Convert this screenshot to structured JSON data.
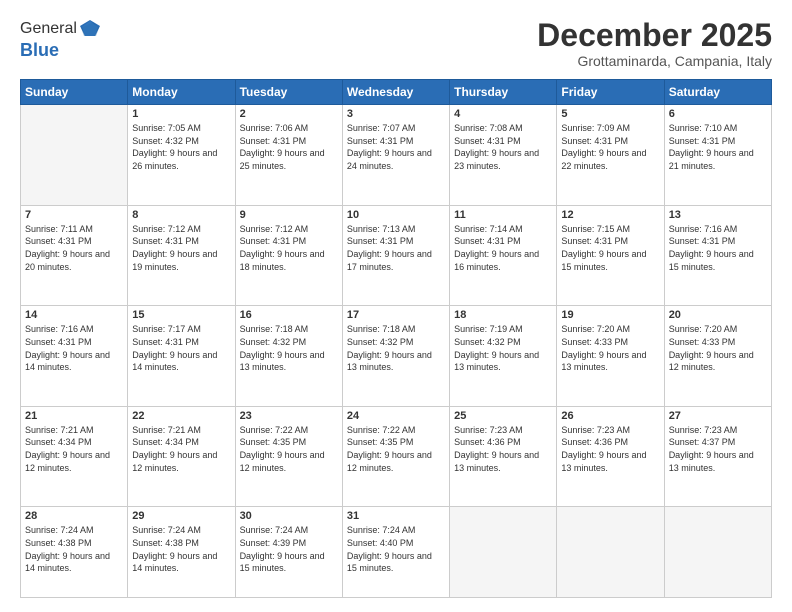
{
  "logo": {
    "general": "General",
    "blue": "Blue"
  },
  "header": {
    "month": "December 2025",
    "location": "Grottaminarda, Campania, Italy"
  },
  "days": [
    "Sunday",
    "Monday",
    "Tuesday",
    "Wednesday",
    "Thursday",
    "Friday",
    "Saturday"
  ],
  "weeks": [
    [
      {
        "num": "",
        "sunrise": "",
        "sunset": "",
        "daylight": ""
      },
      {
        "num": "1",
        "sunrise": "Sunrise: 7:05 AM",
        "sunset": "Sunset: 4:32 PM",
        "daylight": "Daylight: 9 hours and 26 minutes."
      },
      {
        "num": "2",
        "sunrise": "Sunrise: 7:06 AM",
        "sunset": "Sunset: 4:31 PM",
        "daylight": "Daylight: 9 hours and 25 minutes."
      },
      {
        "num": "3",
        "sunrise": "Sunrise: 7:07 AM",
        "sunset": "Sunset: 4:31 PM",
        "daylight": "Daylight: 9 hours and 24 minutes."
      },
      {
        "num": "4",
        "sunrise": "Sunrise: 7:08 AM",
        "sunset": "Sunset: 4:31 PM",
        "daylight": "Daylight: 9 hours and 23 minutes."
      },
      {
        "num": "5",
        "sunrise": "Sunrise: 7:09 AM",
        "sunset": "Sunset: 4:31 PM",
        "daylight": "Daylight: 9 hours and 22 minutes."
      },
      {
        "num": "6",
        "sunrise": "Sunrise: 7:10 AM",
        "sunset": "Sunset: 4:31 PM",
        "daylight": "Daylight: 9 hours and 21 minutes."
      }
    ],
    [
      {
        "num": "7",
        "sunrise": "Sunrise: 7:11 AM",
        "sunset": "Sunset: 4:31 PM",
        "daylight": "Daylight: 9 hours and 20 minutes."
      },
      {
        "num": "8",
        "sunrise": "Sunrise: 7:12 AM",
        "sunset": "Sunset: 4:31 PM",
        "daylight": "Daylight: 9 hours and 19 minutes."
      },
      {
        "num": "9",
        "sunrise": "Sunrise: 7:12 AM",
        "sunset": "Sunset: 4:31 PM",
        "daylight": "Daylight: 9 hours and 18 minutes."
      },
      {
        "num": "10",
        "sunrise": "Sunrise: 7:13 AM",
        "sunset": "Sunset: 4:31 PM",
        "daylight": "Daylight: 9 hours and 17 minutes."
      },
      {
        "num": "11",
        "sunrise": "Sunrise: 7:14 AM",
        "sunset": "Sunset: 4:31 PM",
        "daylight": "Daylight: 9 hours and 16 minutes."
      },
      {
        "num": "12",
        "sunrise": "Sunrise: 7:15 AM",
        "sunset": "Sunset: 4:31 PM",
        "daylight": "Daylight: 9 hours and 15 minutes."
      },
      {
        "num": "13",
        "sunrise": "Sunrise: 7:16 AM",
        "sunset": "Sunset: 4:31 PM",
        "daylight": "Daylight: 9 hours and 15 minutes."
      }
    ],
    [
      {
        "num": "14",
        "sunrise": "Sunrise: 7:16 AM",
        "sunset": "Sunset: 4:31 PM",
        "daylight": "Daylight: 9 hours and 14 minutes."
      },
      {
        "num": "15",
        "sunrise": "Sunrise: 7:17 AM",
        "sunset": "Sunset: 4:31 PM",
        "daylight": "Daylight: 9 hours and 14 minutes."
      },
      {
        "num": "16",
        "sunrise": "Sunrise: 7:18 AM",
        "sunset": "Sunset: 4:32 PM",
        "daylight": "Daylight: 9 hours and 13 minutes."
      },
      {
        "num": "17",
        "sunrise": "Sunrise: 7:18 AM",
        "sunset": "Sunset: 4:32 PM",
        "daylight": "Daylight: 9 hours and 13 minutes."
      },
      {
        "num": "18",
        "sunrise": "Sunrise: 7:19 AM",
        "sunset": "Sunset: 4:32 PM",
        "daylight": "Daylight: 9 hours and 13 minutes."
      },
      {
        "num": "19",
        "sunrise": "Sunrise: 7:20 AM",
        "sunset": "Sunset: 4:33 PM",
        "daylight": "Daylight: 9 hours and 13 minutes."
      },
      {
        "num": "20",
        "sunrise": "Sunrise: 7:20 AM",
        "sunset": "Sunset: 4:33 PM",
        "daylight": "Daylight: 9 hours and 12 minutes."
      }
    ],
    [
      {
        "num": "21",
        "sunrise": "Sunrise: 7:21 AM",
        "sunset": "Sunset: 4:34 PM",
        "daylight": "Daylight: 9 hours and 12 minutes."
      },
      {
        "num": "22",
        "sunrise": "Sunrise: 7:21 AM",
        "sunset": "Sunset: 4:34 PM",
        "daylight": "Daylight: 9 hours and 12 minutes."
      },
      {
        "num": "23",
        "sunrise": "Sunrise: 7:22 AM",
        "sunset": "Sunset: 4:35 PM",
        "daylight": "Daylight: 9 hours and 12 minutes."
      },
      {
        "num": "24",
        "sunrise": "Sunrise: 7:22 AM",
        "sunset": "Sunset: 4:35 PM",
        "daylight": "Daylight: 9 hours and 12 minutes."
      },
      {
        "num": "25",
        "sunrise": "Sunrise: 7:23 AM",
        "sunset": "Sunset: 4:36 PM",
        "daylight": "Daylight: 9 hours and 13 minutes."
      },
      {
        "num": "26",
        "sunrise": "Sunrise: 7:23 AM",
        "sunset": "Sunset: 4:36 PM",
        "daylight": "Daylight: 9 hours and 13 minutes."
      },
      {
        "num": "27",
        "sunrise": "Sunrise: 7:23 AM",
        "sunset": "Sunset: 4:37 PM",
        "daylight": "Daylight: 9 hours and 13 minutes."
      }
    ],
    [
      {
        "num": "28",
        "sunrise": "Sunrise: 7:24 AM",
        "sunset": "Sunset: 4:38 PM",
        "daylight": "Daylight: 9 hours and 14 minutes."
      },
      {
        "num": "29",
        "sunrise": "Sunrise: 7:24 AM",
        "sunset": "Sunset: 4:38 PM",
        "daylight": "Daylight: 9 hours and 14 minutes."
      },
      {
        "num": "30",
        "sunrise": "Sunrise: 7:24 AM",
        "sunset": "Sunset: 4:39 PM",
        "daylight": "Daylight: 9 hours and 15 minutes."
      },
      {
        "num": "31",
        "sunrise": "Sunrise: 7:24 AM",
        "sunset": "Sunset: 4:40 PM",
        "daylight": "Daylight: 9 hours and 15 minutes."
      },
      {
        "num": "",
        "sunrise": "",
        "sunset": "",
        "daylight": ""
      },
      {
        "num": "",
        "sunrise": "",
        "sunset": "",
        "daylight": ""
      },
      {
        "num": "",
        "sunrise": "",
        "sunset": "",
        "daylight": ""
      }
    ]
  ]
}
